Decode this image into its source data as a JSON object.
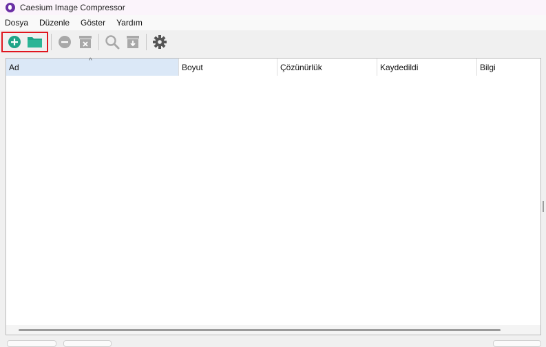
{
  "window": {
    "title": "Caesium Image Compressor"
  },
  "menu": {
    "file": "Dosya",
    "edit": "Düzenle",
    "view": "Göster",
    "help": "Yardım"
  },
  "toolbar": {
    "icons": [
      "add-file-icon",
      "add-folder-icon",
      "remove-icon",
      "clear-list-icon",
      "preview-icon",
      "compress-icon",
      "settings-icon"
    ],
    "colors": {
      "accent": "#1fa488",
      "disabled": "#a8a8a8",
      "settings": "#555555",
      "highlight": "#e0161e"
    }
  },
  "table": {
    "columns": [
      "Ad",
      "Boyut",
      "Çözünürlük",
      "Kaydedildi",
      "Bilgi"
    ],
    "sort_indicator": "^",
    "rows": []
  }
}
